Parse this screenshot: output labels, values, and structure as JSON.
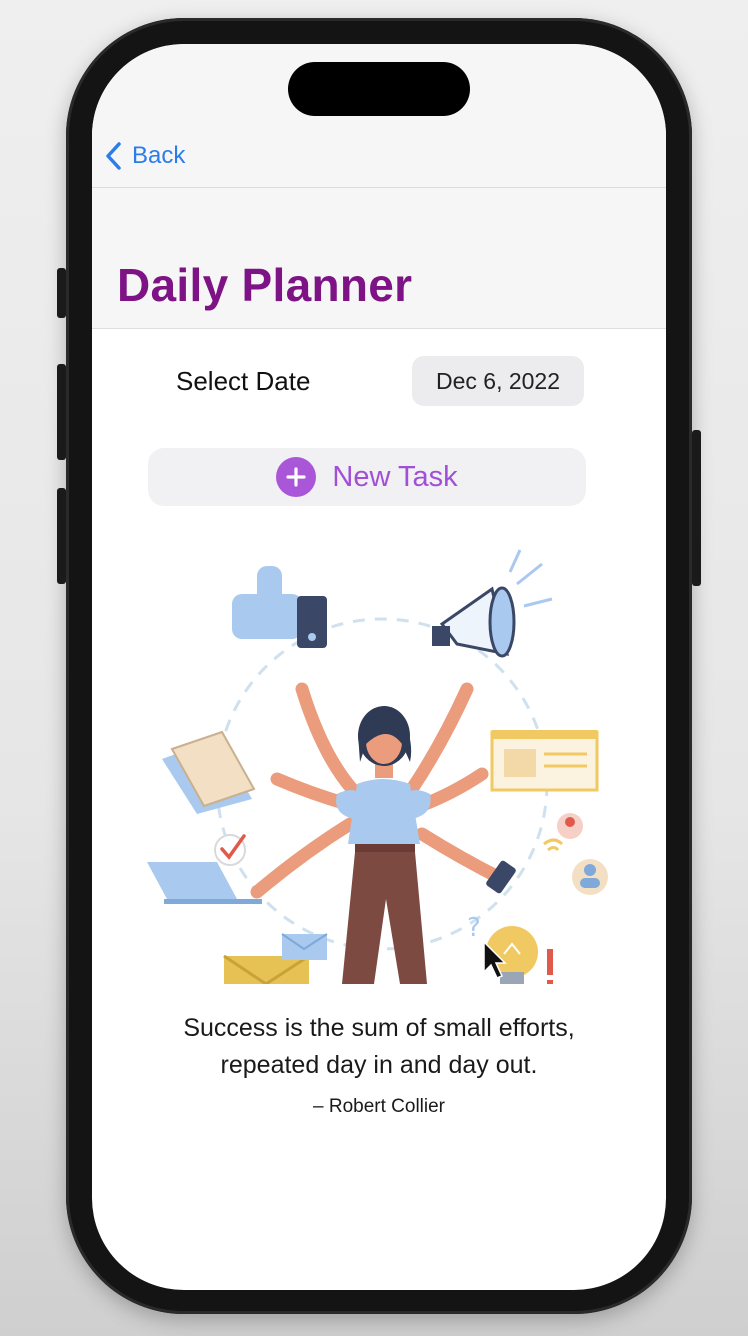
{
  "nav": {
    "back_label": "Back"
  },
  "page": {
    "title": "Daily Planner"
  },
  "date_picker": {
    "label": "Select Date",
    "value": "Dec 6, 2022"
  },
  "actions": {
    "new_task_label": "New Task"
  },
  "quote": {
    "line1": "Success is the sum of small efforts,",
    "line2": "repeated day in and day out.",
    "author": "– Robert Collier"
  },
  "colors": {
    "accent_blue": "#2b7de9",
    "title_purple": "#7d1384",
    "button_purple": "#a956d8"
  },
  "icons": {
    "back": "chevron-left-icon",
    "add": "plus-icon"
  }
}
